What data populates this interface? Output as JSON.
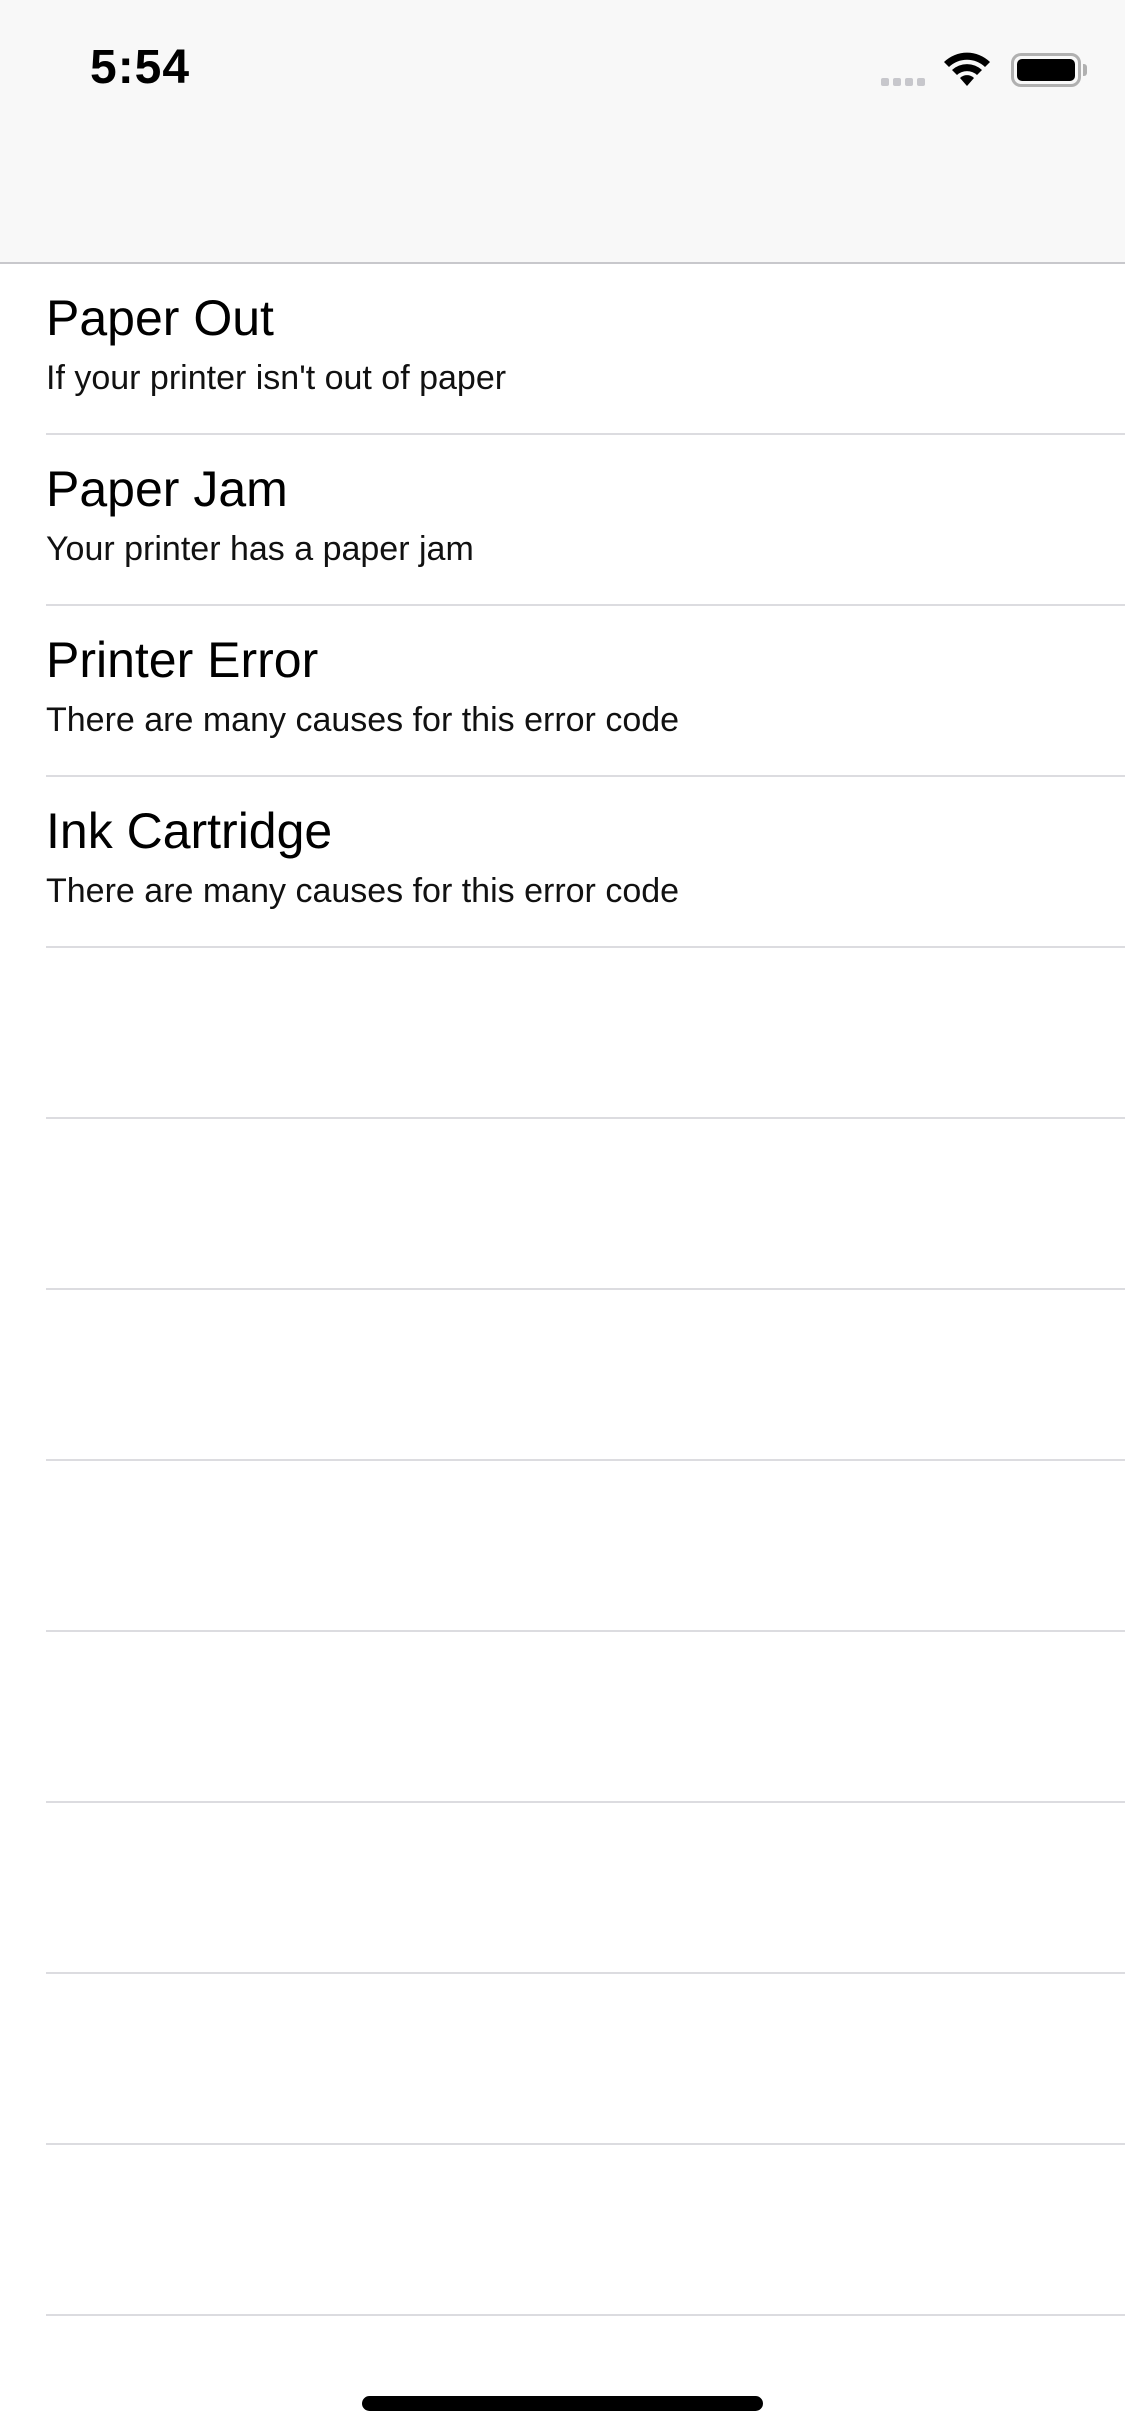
{
  "status_bar": {
    "time": "5:54",
    "signal_icon": "cellular-signal-icon",
    "wifi_icon": "wifi-icon",
    "battery_icon": "battery-full-icon",
    "battery_level": 1.0
  },
  "colors": {
    "nav_background": "#f8f8f8",
    "separator": "#dcdce0",
    "text": "#000000"
  },
  "list": {
    "items": [
      {
        "title": "Paper Out",
        "subtitle": "If your printer isn't out of paper"
      },
      {
        "title": "Paper Jam",
        "subtitle": "Your printer has a paper jam"
      },
      {
        "title": "Printer Error",
        "subtitle": "There are many causes for this error code"
      },
      {
        "title": "Ink Cartridge",
        "subtitle": "There are many causes for this error code"
      }
    ]
  }
}
